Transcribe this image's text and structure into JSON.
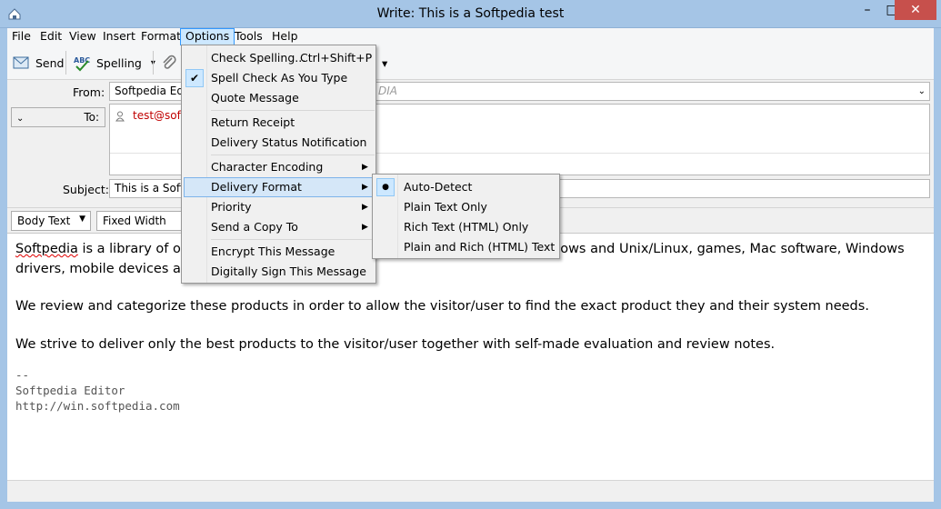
{
  "window": {
    "title": "Write: This is a Softpedia test",
    "buttons": {
      "minimize": "–",
      "maximize": "□",
      "close": "✕"
    }
  },
  "menubar": {
    "items": [
      "File",
      "Edit",
      "View",
      "Insert",
      "Format",
      "Options",
      "Tools",
      "Help"
    ],
    "active": "Options"
  },
  "toolbar": {
    "send": "Send",
    "spelling": "Spelling",
    "dropdown_arrow": "▾"
  },
  "header": {
    "from_label": "From:",
    "from_value": "Softpedia Edit",
    "from_value_tail": "DIA",
    "to_type": "To:",
    "to_value": "test@soft",
    "subject_label": "Subject:",
    "subject_value": "This is a Softp"
  },
  "format_bar": {
    "paragraph_style": "Body Text",
    "font": "Fixed Width"
  },
  "body": {
    "line1a": "Softpedia",
    "line1b": " is a library of ov",
    "line1c": "dows and Unix/Linux, games, Mac software, Windows",
    "line2": "drivers, mobile devices an",
    "para2": "We review and categorize these products in order to allow the visitor/user to find the exact product they and their system needs.",
    "para3": "We strive to deliver only the best products to the visitor/user together with self-made evaluation and review notes.",
    "sig_sep": "--",
    "sig_name": "Softpedia Editor",
    "sig_url": "http://win.softpedia.com"
  },
  "options_menu": {
    "items": [
      {
        "label": "Check Spelling...",
        "accel": "Ctrl+Shift+P"
      },
      {
        "label": "Spell Check As You Type",
        "checked": true
      },
      {
        "label": "Quote Message"
      },
      {
        "label": "Return Receipt"
      },
      {
        "label": "Delivery Status Notification"
      },
      {
        "label": "Character Encoding",
        "submenu": true
      },
      {
        "label": "Delivery Format",
        "submenu": true,
        "highlighted": true
      },
      {
        "label": "Priority",
        "submenu": true
      },
      {
        "label": "Send a Copy To",
        "submenu": true
      },
      {
        "label": "Encrypt This Message"
      },
      {
        "label": "Digitally Sign This Message"
      }
    ]
  },
  "delivery_format_submenu": {
    "items": [
      {
        "label": "Auto-Detect",
        "selected": true
      },
      {
        "label": "Plain Text Only"
      },
      {
        "label": "Rich Text (HTML) Only"
      },
      {
        "label": "Plain and Rich (HTML) Text"
      }
    ]
  },
  "colors": {
    "titlebar": "#a5c5e6",
    "close_button": "#c7504c",
    "menu_highlight": "#d5e7f8",
    "misspelled_underline": "#e00000",
    "recipient_text": "#c00000"
  }
}
